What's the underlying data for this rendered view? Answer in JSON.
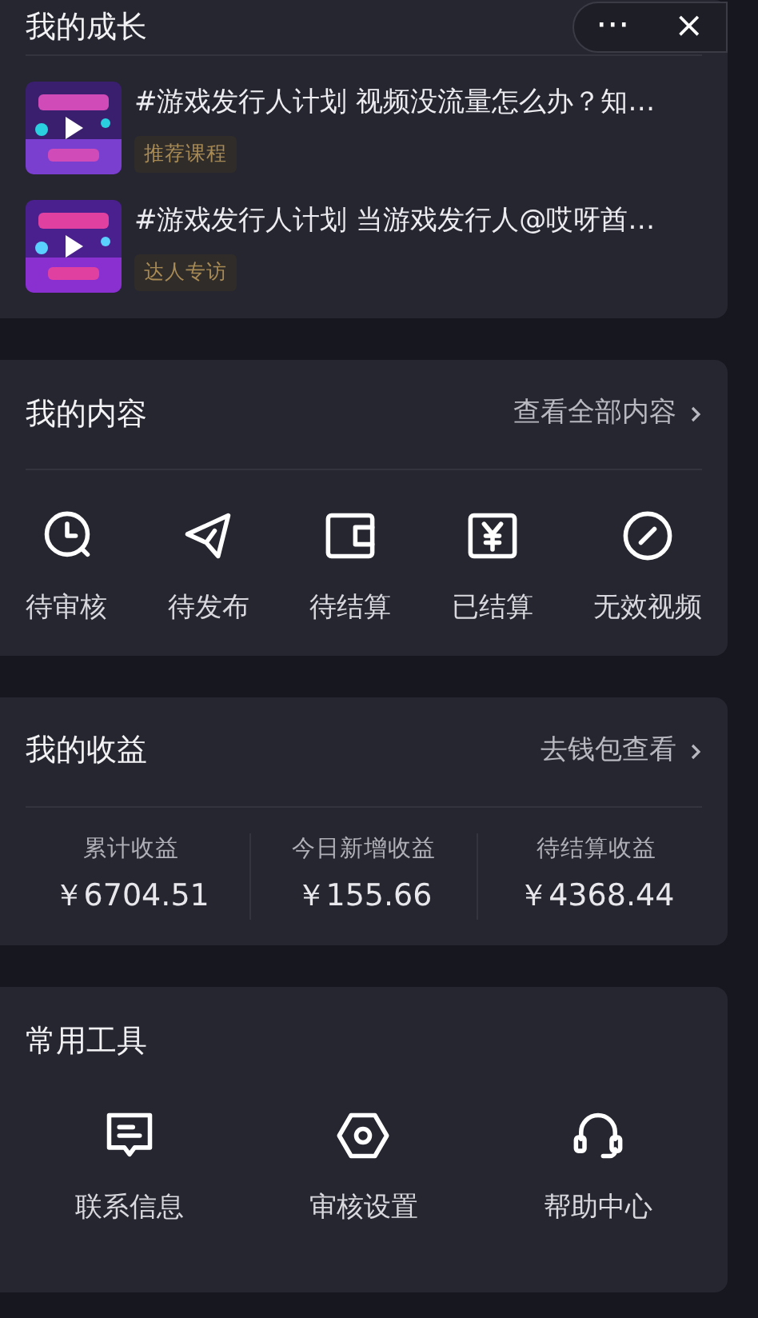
{
  "growth": {
    "title": "我的成长",
    "capsule": {
      "more": "···",
      "close": "×"
    },
    "courses": [
      {
        "title": "#游戏发行人计划 视频没流量怎么办？知…",
        "tag": "推荐课程"
      },
      {
        "title": "#游戏发行人计划 当游戏发行人@哎呀酋…",
        "tag": "达人专访"
      }
    ]
  },
  "content": {
    "title": "我的内容",
    "link": "查看全部内容",
    "items": [
      {
        "label": "待审核"
      },
      {
        "label": "待发布"
      },
      {
        "label": "待结算"
      },
      {
        "label": "已结算"
      },
      {
        "label": "无效视频"
      }
    ]
  },
  "earnings": {
    "title": "我的收益",
    "link": "去钱包查看",
    "stats": [
      {
        "label": "累计收益",
        "value": "￥6704.51"
      },
      {
        "label": "今日新增收益",
        "value": "￥155.66"
      },
      {
        "label": "待结算收益",
        "value": "￥4368.44"
      }
    ]
  },
  "tools": {
    "title": "常用工具",
    "items": [
      {
        "label": "联系信息"
      },
      {
        "label": "审核设置"
      },
      {
        "label": "帮助中心"
      }
    ]
  }
}
